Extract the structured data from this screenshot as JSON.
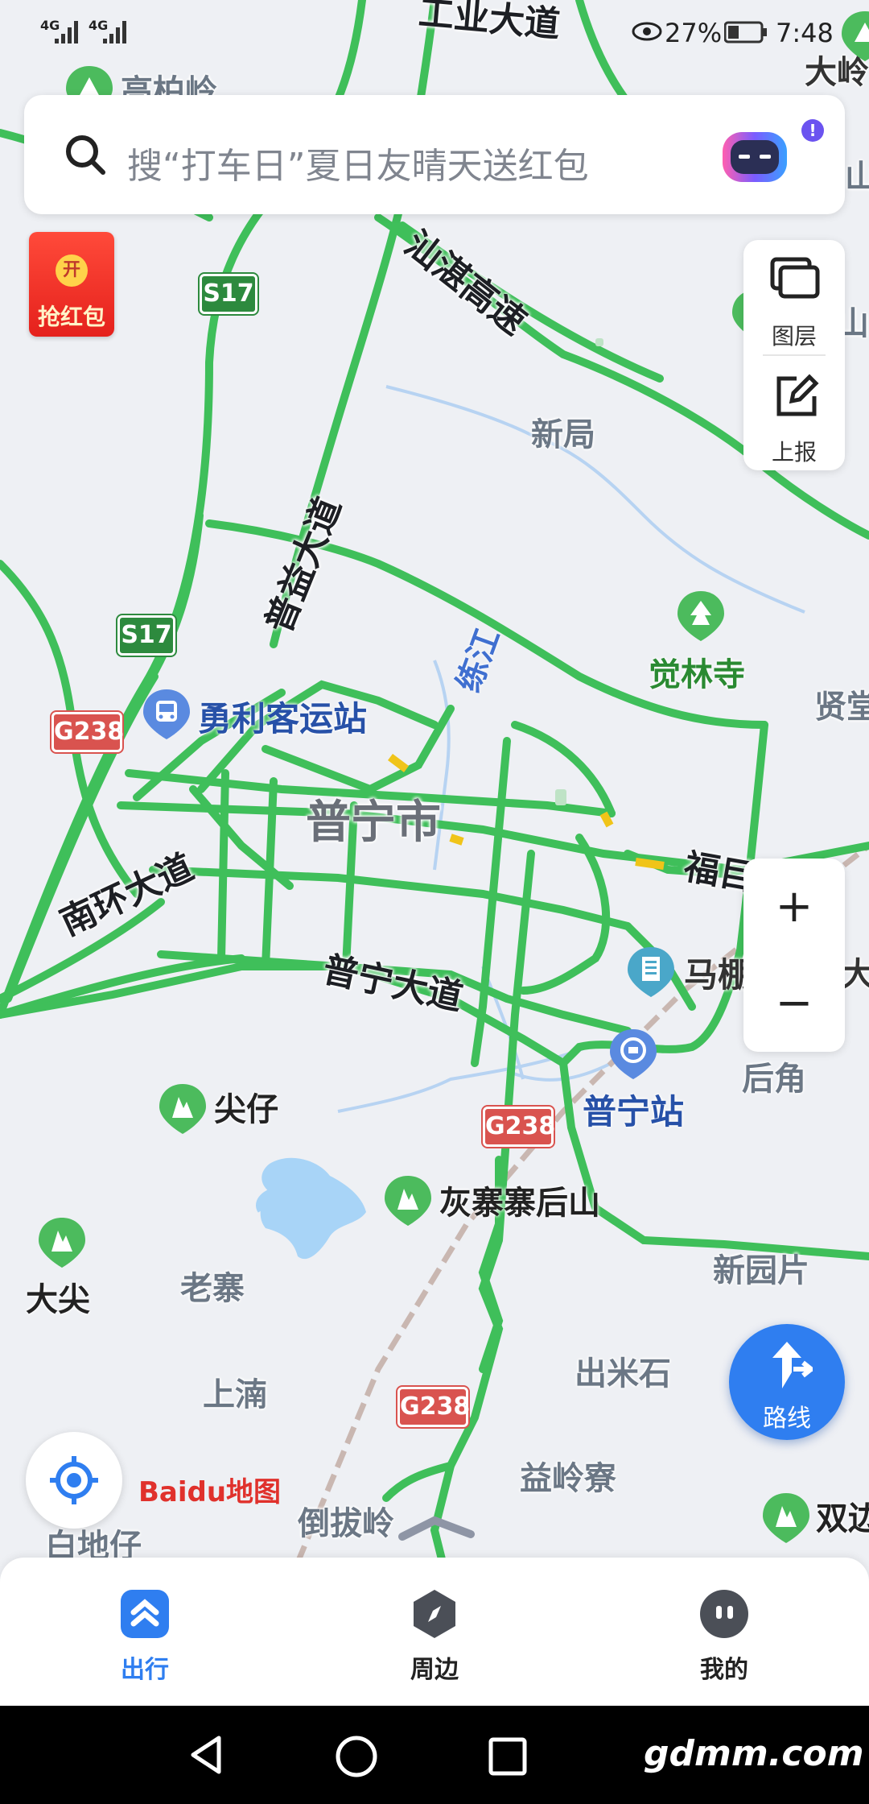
{
  "status_bar": {
    "signal_1": "4G",
    "signal_2": "4G",
    "battery": "27%",
    "time": "7:48"
  },
  "search": {
    "placeholder": "搜“打车日”夏日友晴天送红包",
    "badge": "!"
  },
  "red_packet": {
    "top": "开",
    "label": "抢红包"
  },
  "side_panel": {
    "layers_label": "图层",
    "report_label": "上报"
  },
  "zoom": {
    "in_label": "+",
    "out_label": "−"
  },
  "route_button": {
    "label": "路线"
  },
  "map": {
    "city": "普宁市",
    "roads": {
      "gongye": "工业大道",
      "shantou": "汕湛高速",
      "puyi": "普益大道",
      "nanhuan": "南环大道",
      "puning": "普宁大道",
      "fu": "福目"
    },
    "water": "练江",
    "shields": {
      "s17_a": "S17",
      "s17_b": "S17",
      "g238_a": "G238",
      "g238_b": "G238",
      "g238_c": "G238"
    },
    "places": {
      "gaobailing": "高柏岭",
      "daling": "大岭",
      "shan": "山",
      "shan2": "山",
      "xinju": "新局",
      "xiantang": "贤堂",
      "houjiao": "后角",
      "laozhai": "老寨",
      "shangnan": "上湳",
      "chumishi": "出米石",
      "yilingliao": "益岭寮",
      "xinyuanpian": "新园片",
      "daobaling": "倒拔岭",
      "baidizai": "白地仔",
      "da": "大"
    },
    "pois": {
      "juelinsi": "觉林寺",
      "jianzai": "尖仔",
      "huizhai": "灰寨寨后山",
      "dajian": "大尖",
      "shuang": "双边"
    },
    "blue_pois": {
      "yongli": "勇利客运站",
      "mapeng": "马棚",
      "puning_station": "普宁站"
    },
    "logo": "Baidu地图"
  },
  "bottom_nav": {
    "items": [
      {
        "label": "出行",
        "active": true
      },
      {
        "label": "周边",
        "active": false
      },
      {
        "label": "我的",
        "active": false
      }
    ]
  },
  "watermark": "gdmm.com",
  "colors": {
    "road_green": "#3fbf5a",
    "accent_blue": "#2f7ef0",
    "map_bg": "#eef0f4"
  }
}
